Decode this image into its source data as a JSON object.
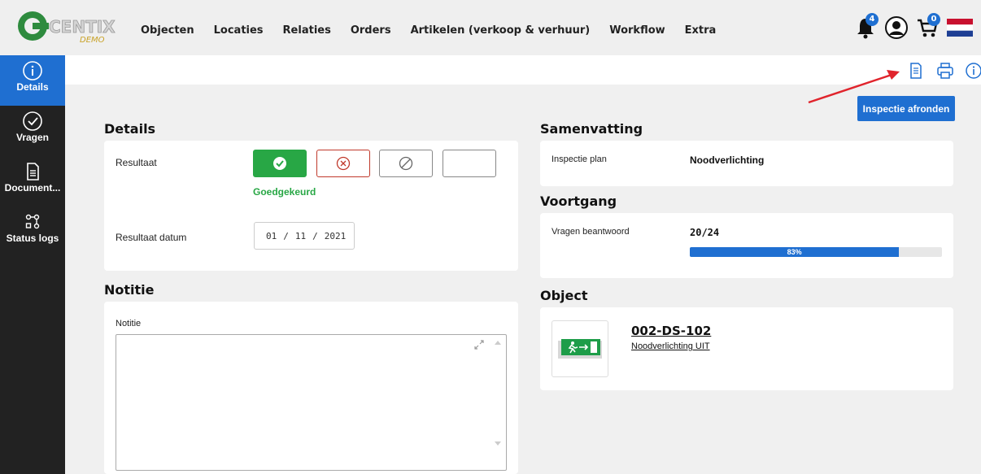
{
  "brand": {
    "logo_text": "CENTIX",
    "logo_sub": "DEMO"
  },
  "nav": [
    "Objecten",
    "Locaties",
    "Relaties",
    "Orders",
    "Artikelen (verkoop & verhuur)",
    "Workflow",
    "Extra"
  ],
  "top_icons": {
    "notifications_count": "4",
    "cart_count": "0"
  },
  "sidebar": [
    {
      "label": "Details",
      "icon": "info-icon",
      "active": true
    },
    {
      "label": "Vragen",
      "icon": "check-circle-icon",
      "active": false
    },
    {
      "label": "Document...",
      "icon": "document-icon",
      "active": false
    },
    {
      "label": "Status logs",
      "icon": "status-log-icon",
      "active": false
    }
  ],
  "actions": {
    "finish_label": "Inspectie afronden"
  },
  "details": {
    "title": "Details",
    "result_label": "Resultaat",
    "result_value": "Goedgekeurd",
    "date_label": "Resultaat datum",
    "date": {
      "day": "01",
      "month": "11",
      "year": "2021"
    }
  },
  "note": {
    "title": "Notitie",
    "label": "Notitie",
    "value": ""
  },
  "summary": {
    "title": "Samenvatting",
    "plan_label": "Inspectie plan",
    "plan_value": "Noodverlichting"
  },
  "progress": {
    "title": "Voortgang",
    "label": "Vragen beantwoord",
    "value": "20/24",
    "percent": 83,
    "percent_text": "83%"
  },
  "object": {
    "title": "Object",
    "code": "002-DS-102",
    "name": "Noodverlichting UIT"
  },
  "colors": {
    "primary": "#1f6fd1",
    "success": "#28a745",
    "danger": "#c0392b",
    "sidebar": "#222222"
  }
}
